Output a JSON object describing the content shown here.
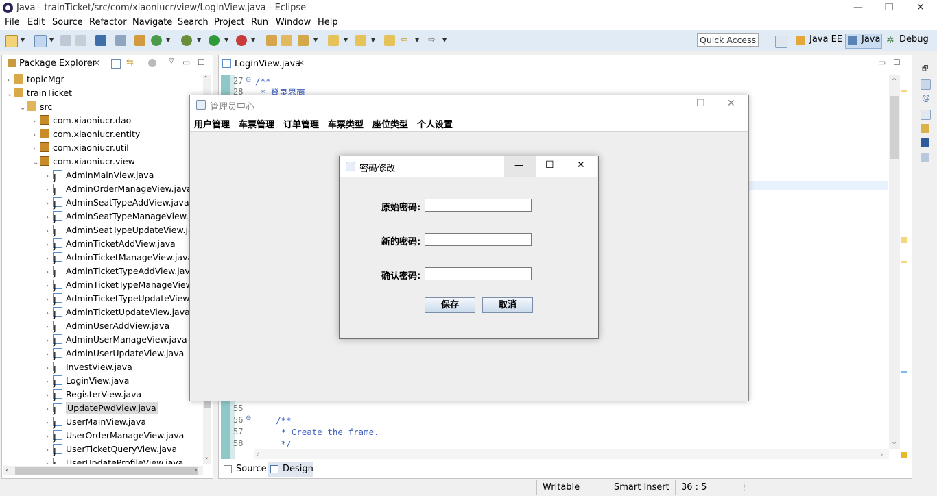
{
  "window": {
    "title": "Java - trainTicket/src/com/xiaoniucr/view/LoginView.java - Eclipse"
  },
  "menu": [
    "File",
    "Edit",
    "Source",
    "Refactor",
    "Navigate",
    "Search",
    "Project",
    "Run",
    "Window",
    "Help"
  ],
  "toolbar": {
    "quick_access": "Quick Access",
    "perspectives": [
      "Java EE",
      "Java",
      "Debug"
    ]
  },
  "package_explorer": {
    "tab": "Package Explorer",
    "projects": [
      "topicMgr",
      "trainTicket"
    ],
    "src": "src",
    "packages": [
      "com.xiaoniucr.dao",
      "com.xiaoniucr.entity",
      "com.xiaoniucr.util",
      "com.xiaoniucr.view"
    ],
    "files": [
      "AdminMainView.java",
      "AdminOrderManageView.java",
      "AdminSeatTypeAddView.java",
      "AdminSeatTypeManageView.java",
      "AdminSeatTypeUpdateView.java",
      "AdminTicketAddView.java",
      "AdminTicketManageView.java",
      "AdminTicketTypeAddView.java",
      "AdminTicketTypeManageView",
      "AdminTicketTypeUpdateView.",
      "AdminTicketUpdateView.java",
      "AdminUserAddView.java",
      "AdminUserManageView.java",
      "AdminUserUpdateView.java",
      "InvestView.java",
      "LoginView.java",
      "RegisterView.java",
      "UpdatePwdView.java",
      "UserMainView.java",
      "UserOrderManageView.java",
      "UserTicketQueryView.java",
      "UserUpdateProfileView.java"
    ],
    "selected": "UpdatePwdView.java"
  },
  "editor": {
    "tab": "LoginView.java",
    "lines_top": [
      {
        "n": "27",
        "t": "/**"
      },
      {
        "n": "28",
        "t": " * 登录界面"
      }
    ],
    "lines_bottom": [
      {
        "n": "55",
        "t": ""
      },
      {
        "n": "56",
        "t": "    /**"
      },
      {
        "n": "57",
        "t": "     * Create the frame."
      },
      {
        "n": "58",
        "t": "     */"
      }
    ],
    "bottom_tabs": [
      "Source",
      "Design"
    ]
  },
  "status": {
    "writable": "Writable",
    "insert_mode": "Smart Insert",
    "position": "36 : 5"
  },
  "admin_frame": {
    "title": "管理员中心",
    "menu": [
      "用户管理",
      "车票管理",
      "订单管理",
      "车票类型",
      "座位类型",
      "个人设置"
    ]
  },
  "dialog": {
    "title": "密码修改",
    "labels": [
      "原始密码:",
      "新的密码:",
      "确认密码:"
    ],
    "save": "保存",
    "cancel": "取消"
  }
}
